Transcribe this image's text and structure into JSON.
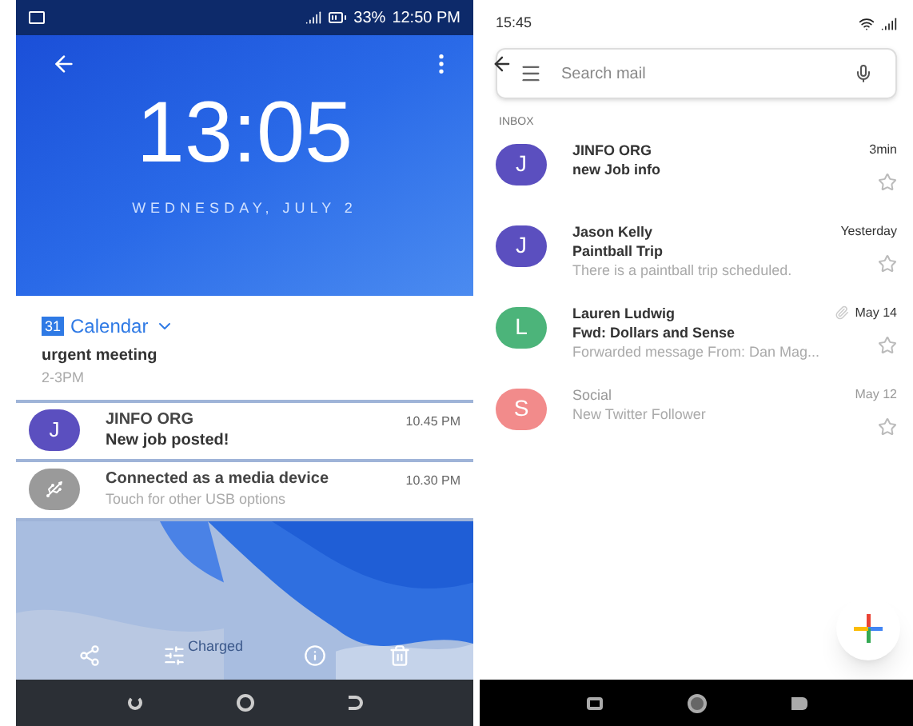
{
  "left_phone": {
    "status_bar": {
      "battery": "33%",
      "time": "12:50 PM"
    },
    "lock": {
      "clock": "13:05",
      "date": "WEDNESDAY, JULY 2"
    },
    "calendar": {
      "badge": "31",
      "app": "Calendar",
      "title": "urgent meeting",
      "time": "2-3PM"
    },
    "notifications": [
      {
        "kind": "avatar",
        "initial": "J",
        "color": "#5b4fbf",
        "title": "JINFO ORG",
        "body": "New job posted!",
        "time": "10.45 PM"
      },
      {
        "kind": "usb",
        "title": "Connected as a media device",
        "body": "Touch for other USB options",
        "time": "10.30 PM"
      }
    ],
    "charge_text": "Charged"
  },
  "right_phone": {
    "status_bar": {
      "time": "15:45"
    },
    "search": {
      "placeholder": "Search mail"
    },
    "section": "INBOX",
    "emails": [
      {
        "initial": "J",
        "color": "#5b4fbf",
        "sender": "JINFO ORG",
        "subject": "new Job info",
        "time": "3min",
        "unread": true
      },
      {
        "initial": "J",
        "color": "#5b4fbf",
        "sender": "Jason Kelly",
        "subject": "Paintball Trip",
        "snippet": "There is a paintball trip scheduled.",
        "time": "Yesterday",
        "unread": true
      },
      {
        "initial": "L",
        "color": "#4cb47a",
        "sender": "Lauren Ludwig",
        "subject": "Fwd: Dollars and Sense",
        "snippet": "Forwarded message  From: Dan Mag...",
        "time": "May 14",
        "unread": true,
        "attachment": true
      },
      {
        "initial": "S",
        "color": "#f28b8b",
        "sender": "Social",
        "snippet": "New Twitter Follower",
        "time": "May 12",
        "unread": false
      }
    ]
  }
}
